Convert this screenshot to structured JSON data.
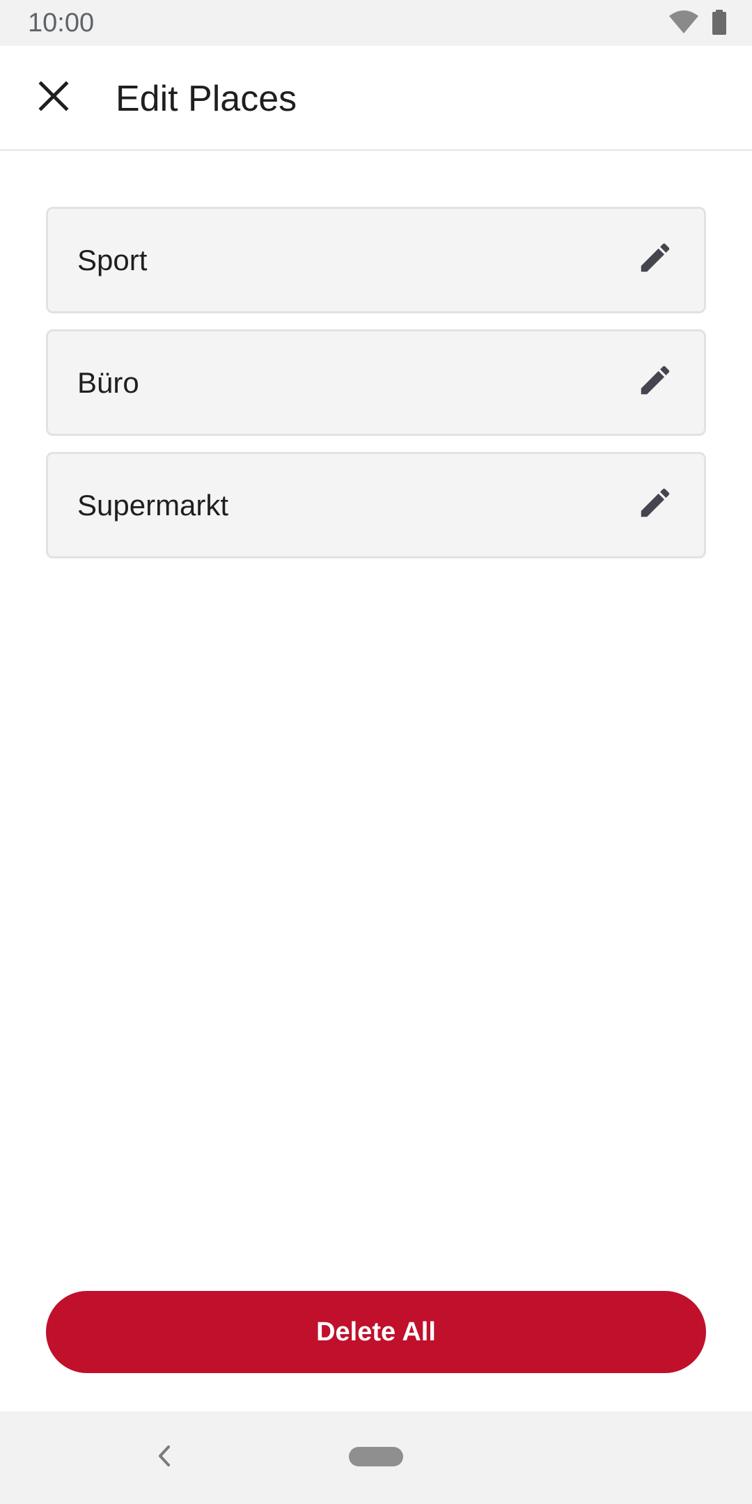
{
  "status_bar": {
    "time": "10:00",
    "icons": [
      "wifi-icon",
      "battery-icon"
    ]
  },
  "app_bar": {
    "close_icon": "close-icon",
    "title": "Edit Places"
  },
  "places": [
    {
      "label": "Sport",
      "action_icon": "pencil-icon"
    },
    {
      "label": "Büro",
      "action_icon": "pencil-icon"
    },
    {
      "label": "Supermarkt",
      "action_icon": "pencil-icon"
    }
  ],
  "delete_all": {
    "label": "Delete All",
    "color": "#c0102c"
  },
  "nav_bar": {
    "back_icon": "back-chevron-icon",
    "home_icon": "home-pill-icon"
  },
  "colors": {
    "accent": "#c0102c",
    "item_background": "#f4f4f4",
    "system_bar": "#f2f2f2",
    "icon_dark": "#45454f"
  }
}
